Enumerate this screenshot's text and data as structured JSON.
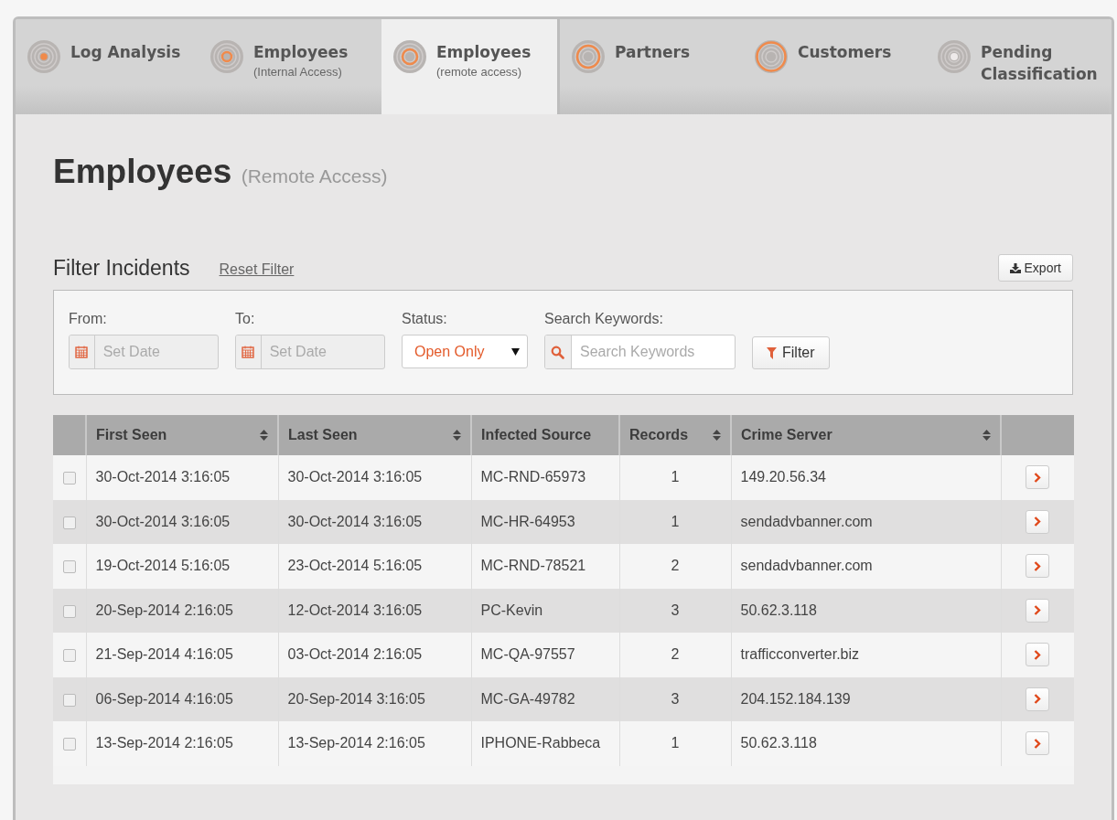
{
  "tabs": [
    {
      "label": "Log Analysis",
      "kind": "dot",
      "selected": false
    },
    {
      "label": "Employees",
      "sublabel": "(Internal Access)",
      "kind": "inner",
      "selected": false
    },
    {
      "label": "Employees",
      "sublabel": "(remote access)",
      "kind": "middle",
      "selected": true
    },
    {
      "label": "Partners",
      "kind": "outer",
      "selected": false
    },
    {
      "label": "Customers",
      "kind": "edge",
      "selected": false
    },
    {
      "label": "Pending Classification",
      "kind": "none",
      "selected": false
    }
  ],
  "page": {
    "title": "Employees",
    "subtitle": "(Remote Access)"
  },
  "filter": {
    "title": "Filter Incidents",
    "reset_link": "Reset Filter",
    "export_button": "Export",
    "from": {
      "label": "From:",
      "placeholder": "Set Date"
    },
    "to": {
      "label": "To:",
      "placeholder": "Set Date"
    },
    "status": {
      "label": "Status:",
      "value": "Open Only"
    },
    "search": {
      "label": "Search Keywords:",
      "placeholder": "Search Keywords"
    },
    "filter_button": "Filter"
  },
  "table": {
    "columns": [
      {
        "label": "First Seen",
        "sortable": true
      },
      {
        "label": "Last Seen",
        "sortable": true
      },
      {
        "label": "Infected Source",
        "sortable": false
      },
      {
        "label": "Records",
        "sortable": true
      },
      {
        "label": "Crime Server",
        "sortable": true
      }
    ],
    "rows": [
      {
        "checked": false,
        "cells": [
          "30-Oct-2014 3:16:05",
          "30-Oct-2014 3:16:05",
          "MC-RND-65973",
          "1",
          "149.20.56.34"
        ]
      },
      {
        "checked": false,
        "cells": [
          "30-Oct-2014 3:16:05",
          "30-Oct-2014 3:16:05",
          "MC-HR-64953",
          "1",
          "sendadvbanner.com"
        ]
      },
      {
        "checked": false,
        "cells": [
          "19-Oct-2014 5:16:05",
          "23-Oct-2014 5:16:05",
          "MC-RND-78521",
          "2",
          "sendadvbanner.com"
        ]
      },
      {
        "checked": false,
        "cells": [
          "20-Sep-2014 2:16:05",
          "12-Oct-2014 3:16:05",
          "PC-Kevin",
          "3",
          "50.62.3.118"
        ]
      },
      {
        "checked": false,
        "cells": [
          "21-Sep-2014 4:16:05",
          "03-Oct-2014 2:16:05",
          "MC-QA-97557",
          "2",
          "trafficconverter.biz"
        ]
      },
      {
        "checked": false,
        "cells": [
          "06-Sep-2014 4:16:05",
          "20-Sep-2014 3:16:05",
          "MC-GA-49782",
          "3",
          "204.152.184.139"
        ]
      },
      {
        "checked": false,
        "cells": [
          "13-Sep-2014 2:16:05",
          "13-Sep-2014 2:16:05",
          "IPHONE-Rabbeca",
          "1",
          "50.62.3.118"
        ]
      }
    ]
  }
}
